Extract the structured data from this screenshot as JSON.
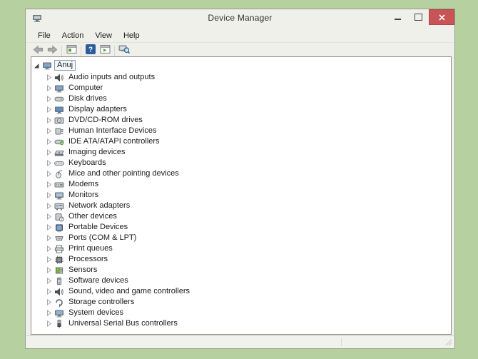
{
  "window": {
    "title": "Device Manager",
    "controls": [
      {
        "name": "minimize",
        "icon": "minimize-icon"
      },
      {
        "name": "maximize",
        "icon": "maximize-icon"
      },
      {
        "name": "close",
        "icon": "close-icon"
      }
    ],
    "app_icon": "device-manager-icon"
  },
  "menu": {
    "items": [
      "File",
      "Action",
      "View",
      "Help"
    ]
  },
  "toolbar": {
    "buttons": [
      {
        "type": "button",
        "name": "back-button",
        "icon": "back-arrow-icon"
      },
      {
        "type": "button",
        "name": "forward-button",
        "icon": "forward-arrow-icon"
      },
      {
        "type": "separator"
      },
      {
        "type": "button",
        "name": "show-console-tree-button",
        "icon": "console-window-icon"
      },
      {
        "type": "separator"
      },
      {
        "type": "button",
        "name": "help-button",
        "icon": "help-icon"
      },
      {
        "type": "button",
        "name": "action-pane-button",
        "icon": "action-pane-icon"
      },
      {
        "type": "separator"
      },
      {
        "type": "button",
        "name": "scan-hardware-changes-button",
        "icon": "scan-computer-icon"
      }
    ]
  },
  "tree": {
    "root": {
      "label": "Anuj",
      "icon": "computer-icon",
      "expanded": true,
      "selected": true
    },
    "items": [
      {
        "label": "Audio inputs and outputs",
        "icon": "speaker-icon"
      },
      {
        "label": "Computer",
        "icon": "computer-icon"
      },
      {
        "label": "Disk drives",
        "icon": "disk-drive-icon"
      },
      {
        "label": "Display adapters",
        "icon": "display-adapter-icon"
      },
      {
        "label": "DVD/CD-ROM drives",
        "icon": "dvd-drive-icon"
      },
      {
        "label": "Human Interface Devices",
        "icon": "hid-icon"
      },
      {
        "label": "IDE ATA/ATAPI controllers",
        "icon": "ide-controller-icon"
      },
      {
        "label": "Imaging devices",
        "icon": "imaging-device-icon"
      },
      {
        "label": "Keyboards",
        "icon": "keyboard-icon"
      },
      {
        "label": "Mice and other pointing devices",
        "icon": "mouse-icon"
      },
      {
        "label": "Modems",
        "icon": "modem-icon"
      },
      {
        "label": "Monitors",
        "icon": "monitor-icon"
      },
      {
        "label": "Network adapters",
        "icon": "network-adapter-icon"
      },
      {
        "label": "Other devices",
        "icon": "unknown-device-icon"
      },
      {
        "label": "Portable Devices",
        "icon": "portable-device-icon"
      },
      {
        "label": "Ports (COM & LPT)",
        "icon": "serial-port-icon"
      },
      {
        "label": "Print queues",
        "icon": "printer-icon"
      },
      {
        "label": "Processors",
        "icon": "processor-icon"
      },
      {
        "label": "Sensors",
        "icon": "sensor-icon"
      },
      {
        "label": "Software devices",
        "icon": "software-device-icon"
      },
      {
        "label": "Sound, video and game controllers",
        "icon": "speaker-icon"
      },
      {
        "label": "Storage controllers",
        "icon": "storage-controller-icon"
      },
      {
        "label": "System devices",
        "icon": "system-device-icon"
      },
      {
        "label": "Universal Serial Bus controllers",
        "icon": "usb-controller-icon"
      }
    ]
  },
  "colors": {
    "desktop_bg": "#b6d09f",
    "window_chrome": "#f0f0ea",
    "close_button_red": "#c85456",
    "help_icon_blue": "#2d5c9e",
    "tree_panel_bg": "#ffffff",
    "text": "#1c1c1c"
  }
}
